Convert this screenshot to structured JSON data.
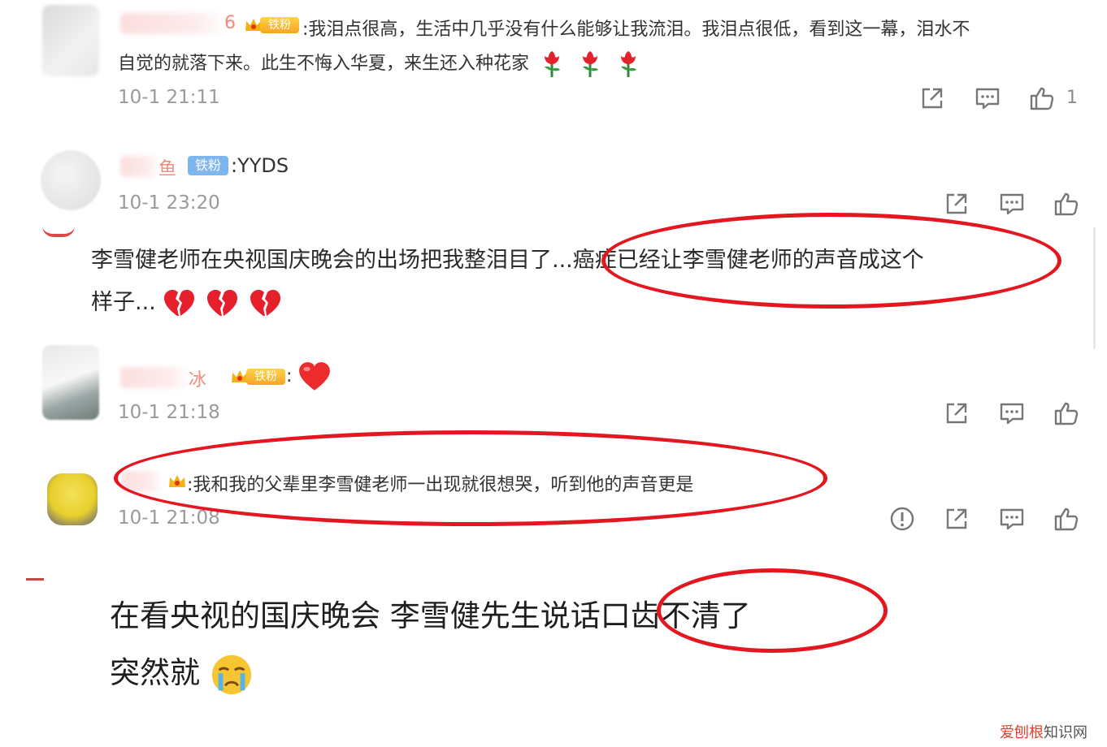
{
  "comments": [
    {
      "user_suffix": "6",
      "badge": "铁粉",
      "text_line1": ":我泪点很高，生活中几乎没有什么能够让我流泪。我泪点很低，看到这一幕，泪水不",
      "text_line2": "自觉的就落下来。此生不悔入华夏，来生还入种花家",
      "time": "10-1 21:11",
      "like_count": "1"
    },
    {
      "user_suffix": "鱼",
      "badge": "铁粉",
      "text": ":YYDS",
      "time": "10-1 23:20"
    },
    {
      "user_suffix": "冰",
      "badge": "铁粉",
      "text": ":",
      "time": "10-1 21:18"
    },
    {
      "text": ":我和我的父辈里李雪健老师一出现就很想哭，听到他的声音更是",
      "time": "10-1 21:08"
    }
  ],
  "quote1": {
    "line1": "李雪健老师在央视国庆晚会的出场把我整泪目了...癌症已经让李雪健老师的声音成这个",
    "line2": "样子..."
  },
  "quote2": {
    "line1": "在看央视的国庆晚会 李雪健先生说话口齿不清了",
    "line2": "突然就"
  },
  "watermark": {
    "brand": "爱刨根",
    "suffix": "知识网"
  },
  "icons": {
    "share": "share-icon",
    "comment": "comment-icon",
    "like": "thumbs-up-icon",
    "report": "report-icon",
    "rose": "rose-emoji-icon",
    "heart": "heart-emoji-icon",
    "broken_heart": "broken-heart-emoji-icon",
    "crying": "crying-face-emoji-icon"
  },
  "colors": {
    "highlight_ring": "#e4161f",
    "badge_gold": "#f5a623",
    "badge_blue": "#7fb6ef",
    "timestamp": "#9a9a9a"
  }
}
